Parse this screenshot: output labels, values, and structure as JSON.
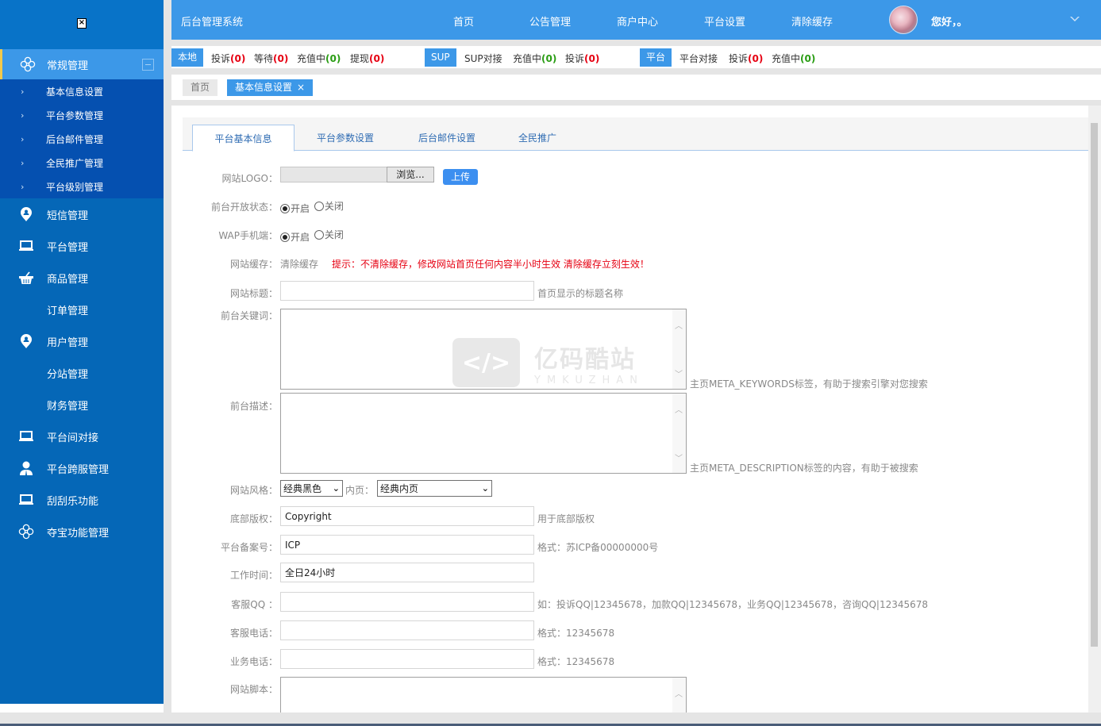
{
  "sidebar": {
    "logo_icon": "broken-image-icon",
    "groups": [
      {
        "label": "常规管理",
        "icon": "clover-icon",
        "expanded": true,
        "children": [
          "基本信息设置",
          "平台参数管理",
          "后台邮件管理",
          "全民推广管理",
          "平台级别管理"
        ]
      }
    ],
    "items": [
      {
        "label": "短信管理",
        "icon": "map-pin-user-icon"
      },
      {
        "label": "平台管理",
        "icon": "laptop-icon"
      },
      {
        "label": "商品管理",
        "icon": "basket-icon"
      },
      {
        "label": "订单管理",
        "icon": ""
      },
      {
        "label": "用户管理",
        "icon": "map-pin-user-icon"
      },
      {
        "label": "分站管理",
        "icon": ""
      },
      {
        "label": "财务管理",
        "icon": ""
      },
      {
        "label": "平台间对接",
        "icon": "laptop-icon"
      },
      {
        "label": "平台跨服管理",
        "icon": "user-icon"
      },
      {
        "label": "刮刮乐功能",
        "icon": "laptop-icon"
      },
      {
        "label": "夺宝功能管理",
        "icon": "clover-icon"
      }
    ]
  },
  "header": {
    "title": "后台管理系统",
    "nav": [
      "首页",
      "公告管理",
      "商户中心",
      "平台设置",
      "清除缓存"
    ],
    "greeting": "您好，。"
  },
  "statusbar": {
    "local": {
      "tag": "本地",
      "items": [
        {
          "label": "投诉",
          "count": "(0)",
          "color": "red"
        },
        {
          "label": "等待",
          "count": "(0)",
          "color": "red"
        },
        {
          "label": "充值中",
          "count": "(0)",
          "color": "green"
        },
        {
          "label": "提现",
          "count": "(0)",
          "color": "red"
        }
      ]
    },
    "sup": {
      "tag": "SUP",
      "items": [
        {
          "label": "SUP对接",
          "count": "",
          "color": ""
        },
        {
          "label": "充值中",
          "count": "(0)",
          "color": "green"
        },
        {
          "label": "投诉",
          "count": "(0)",
          "color": "red"
        }
      ]
    },
    "platform": {
      "tag": "平台",
      "items": [
        {
          "label": "平台对接",
          "count": "",
          "color": ""
        },
        {
          "label": "投诉",
          "count": "(0)",
          "color": "red"
        },
        {
          "label": "充值中",
          "count": "(0)",
          "color": "green"
        }
      ]
    }
  },
  "breadcrumb": {
    "home": "首页",
    "current": "基本信息设置",
    "close": "×"
  },
  "tabs": [
    "平台基本信息",
    "平台参数设置",
    "后台邮件设置",
    "全民推广"
  ],
  "form": {
    "logo": {
      "label": "网站LOGO：",
      "browse": "浏览...",
      "upload": "上传"
    },
    "front_status": {
      "label": "前台开放状态：",
      "options": [
        "开启",
        "关闭"
      ],
      "selected": "开启"
    },
    "wap": {
      "label": "WAP手机端：",
      "options": [
        "开启",
        "关闭"
      ],
      "selected": "开启"
    },
    "cache": {
      "label": "网站缓存：",
      "link": "清除缓存",
      "tip": "提示：不清除缓存，修改网站首页任何内容半小时生效 清除缓存立刻生效！"
    },
    "title": {
      "label": "网站标题：",
      "value": "",
      "hint": "首页显示的标题名称"
    },
    "keywords": {
      "label": "前台关键词：",
      "value": "",
      "hint": "主页META_KEYWORDS标签，有助于搜索引擎对您搜索"
    },
    "description": {
      "label": "前台描述：",
      "value": "",
      "hint": "主页META_DESCRIPTION标签的内容，有助于被搜索"
    },
    "style": {
      "label": "网站风格：",
      "value": "经典黑色",
      "inner_label": "内页：",
      "inner_value": "经典内页"
    },
    "copyright": {
      "label": "底部版权：",
      "value": "Copyright",
      "hint": "用于底部版权"
    },
    "icp": {
      "label": "平台备案号：",
      "value": "ICP",
      "hint": "格式：苏ICP备00000000号"
    },
    "worktime": {
      "label": "工作时间：",
      "value": "全日24小时"
    },
    "qq": {
      "label": "客服QQ ：",
      "value": "",
      "hint": "如：投诉QQ|12345678，加款QQ|12345678，业务QQ|12345678，咨询QQ|12345678"
    },
    "phone": {
      "label": "客服电话：",
      "value": "",
      "hint": "格式：12345678"
    },
    "biz_phone": {
      "label": "业务电话：",
      "value": "",
      "hint": "格式：12345678"
    },
    "script": {
      "label": "网站脚本：",
      "value": ""
    }
  },
  "watermark": {
    "cn": "亿码酷站",
    "en": "YMKUZHAN",
    "glyph": "</>"
  },
  "colors": {
    "primary": "#3c98e8",
    "sidebar": "#0567b7",
    "submenu": "#0550b0",
    "red": "#e60012",
    "green": "#2a9d14",
    "accent_bar": "#f2c94c"
  }
}
